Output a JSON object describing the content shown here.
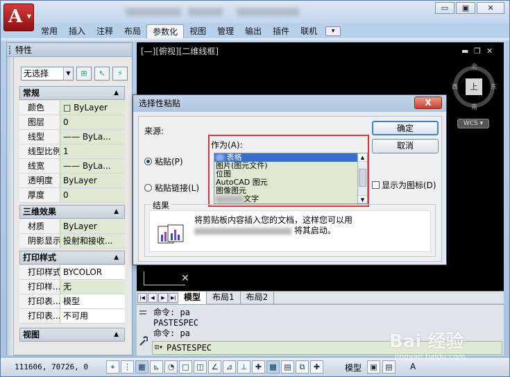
{
  "app": {
    "logo_letter": "A",
    "tabs": [
      "常用",
      "插入",
      "注释",
      "布局",
      "参数化",
      "视图",
      "管理",
      "输出",
      "插件",
      "联机"
    ],
    "active_tab_index": 4
  },
  "window_controls": {
    "minimize": "▭",
    "restore": "▣",
    "close": "✕"
  },
  "properties": {
    "title": "特性",
    "selection": "无选择",
    "sections": {
      "general": "常规",
      "three_d": "三维效果",
      "print": "打印样式",
      "view": "视图"
    },
    "general_rows": [
      {
        "key": "颜色",
        "value": "□ ByLayer"
      },
      {
        "key": "图层",
        "value": "0"
      },
      {
        "key": "线型",
        "value": "—— ByLa..."
      },
      {
        "key": "线型比例",
        "value": "1"
      },
      {
        "key": "线宽",
        "value": "—— ByLa..."
      },
      {
        "key": "透明度",
        "value": "ByLayer"
      },
      {
        "key": "厚度",
        "value": "0"
      }
    ],
    "three_d_rows": [
      {
        "key": "材质",
        "value": "ByLayer"
      },
      {
        "key": "阴影显示",
        "value": "投射和接收..."
      }
    ],
    "print_rows": [
      {
        "key": "打印样式",
        "value": "BYCOLOR"
      },
      {
        "key": "打印样...",
        "value": "无"
      },
      {
        "key": "打印表...",
        "value": "模型"
      },
      {
        "key": "打印表...",
        "value": "不可用"
      }
    ]
  },
  "viewport": {
    "label": "[—][俯视][二维线框]",
    "compass": {
      "north": "北",
      "south": "南",
      "east": "东",
      "west": "西",
      "top": "上"
    },
    "wcs": "WCS"
  },
  "layout_tabs": [
    "模型",
    "布局1",
    "布局2"
  ],
  "command": {
    "history": [
      "命令: pa",
      "PASTESPEC",
      "命令: pa"
    ],
    "current": "PASTESPEC"
  },
  "status": {
    "coords": "111606,  70726,  0",
    "model_label": "模型",
    "scale_label": "A"
  },
  "dialog": {
    "title": "选择性粘贴",
    "close": "X",
    "source_label": "来源:",
    "as_label": "作为(A):",
    "paste_option": "粘贴(P)",
    "paste_link_option": "粘贴链接(L)",
    "list_items": [
      "表格",
      "图片(图元文件)",
      "位图",
      "AutoCAD 图元",
      "图像图元",
      "文字"
    ],
    "display_icon": "显示为图标(D)",
    "ok": "确定",
    "cancel": "取消",
    "result_label": "结果",
    "result_line1": "将剪贴板内容插入您的文档，这样您可以用",
    "result_line2": "将其启动。"
  },
  "watermark": {
    "main": "Bai 经验",
    "sub": "jingyan.baidu.com"
  },
  "colors": {
    "highlight_red": "#e03636",
    "value_green": "#dde9d2",
    "canvas": "#000000"
  }
}
